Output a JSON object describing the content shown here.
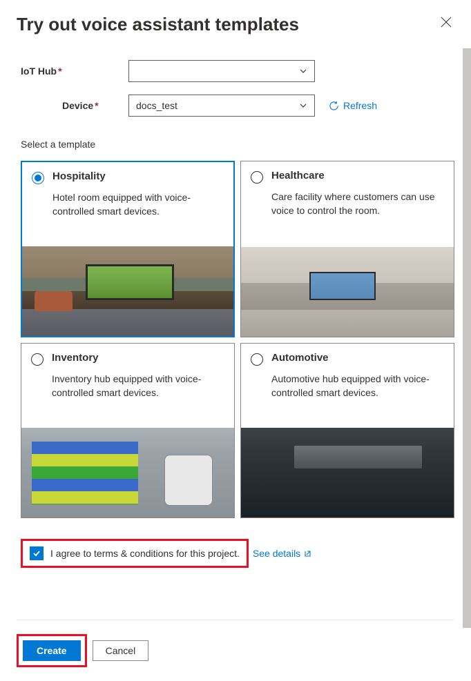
{
  "header": {
    "title": "Try out voice assistant templates"
  },
  "form": {
    "iot_hub_label": "IoT Hub",
    "iot_hub_value": "",
    "device_label": "Device",
    "device_value": "docs_test",
    "refresh_label": "Refresh"
  },
  "templates": {
    "section_label": "Select a template",
    "items": [
      {
        "title": "Hospitality",
        "description": "Hotel room equipped with voice-controlled smart devices.",
        "selected": true
      },
      {
        "title": "Healthcare",
        "description": "Care facility where customers can use voice to control the room.",
        "selected": false
      },
      {
        "title": "Inventory",
        "description": "Inventory hub equipped with voice-controlled smart devices.",
        "selected": false
      },
      {
        "title": "Automotive",
        "description": "Automotive hub equipped with voice-controlled smart devices.",
        "selected": false
      }
    ]
  },
  "terms": {
    "checkbox_checked": true,
    "text": "I agree to terms & conditions for this project.",
    "see_details": "See details"
  },
  "footer": {
    "create_label": "Create",
    "cancel_label": "Cancel"
  }
}
